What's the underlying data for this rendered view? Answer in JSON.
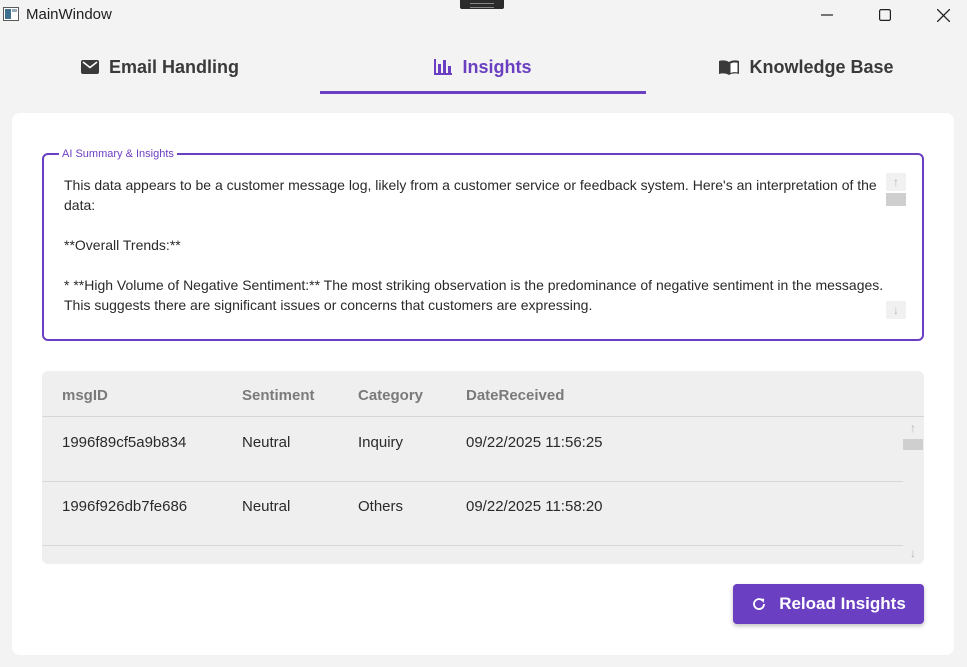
{
  "window": {
    "title": "MainWindow"
  },
  "tabs": [
    {
      "label": "Email Handling",
      "icon": "envelope-icon",
      "selected": false
    },
    {
      "label": "Insights",
      "icon": "bar-chart-icon",
      "selected": true
    },
    {
      "label": "Knowledge Base",
      "icon": "book-icon",
      "selected": false
    }
  ],
  "summary": {
    "legend": "AI Summary & Insights",
    "paragraphs": [
      "This data appears to be a customer message log, likely from a customer service or feedback system. Here's an interpretation of the data:",
      "**Overall Trends:**",
      "* **High Volume of Negative Sentiment:** The most striking observation is the predominance of negative sentiment in the messages. This suggests there are significant issues or concerns that customers are expressing."
    ]
  },
  "table": {
    "columns": [
      "msgID",
      "Sentiment",
      "Category",
      "DateReceived"
    ],
    "rows": [
      [
        "1996f89cf5a9b834",
        "Neutral",
        "Inquiry",
        "09/22/2025 11:56:25"
      ],
      [
        "1996f926db7fe686",
        "Neutral",
        "Others",
        "09/22/2025 11:58:20"
      ]
    ]
  },
  "actions": {
    "reload_label": "Reload Insights"
  },
  "colors": {
    "accent": "#6b3fc1",
    "card": "#ffffff",
    "background": "#f3f3f3"
  }
}
